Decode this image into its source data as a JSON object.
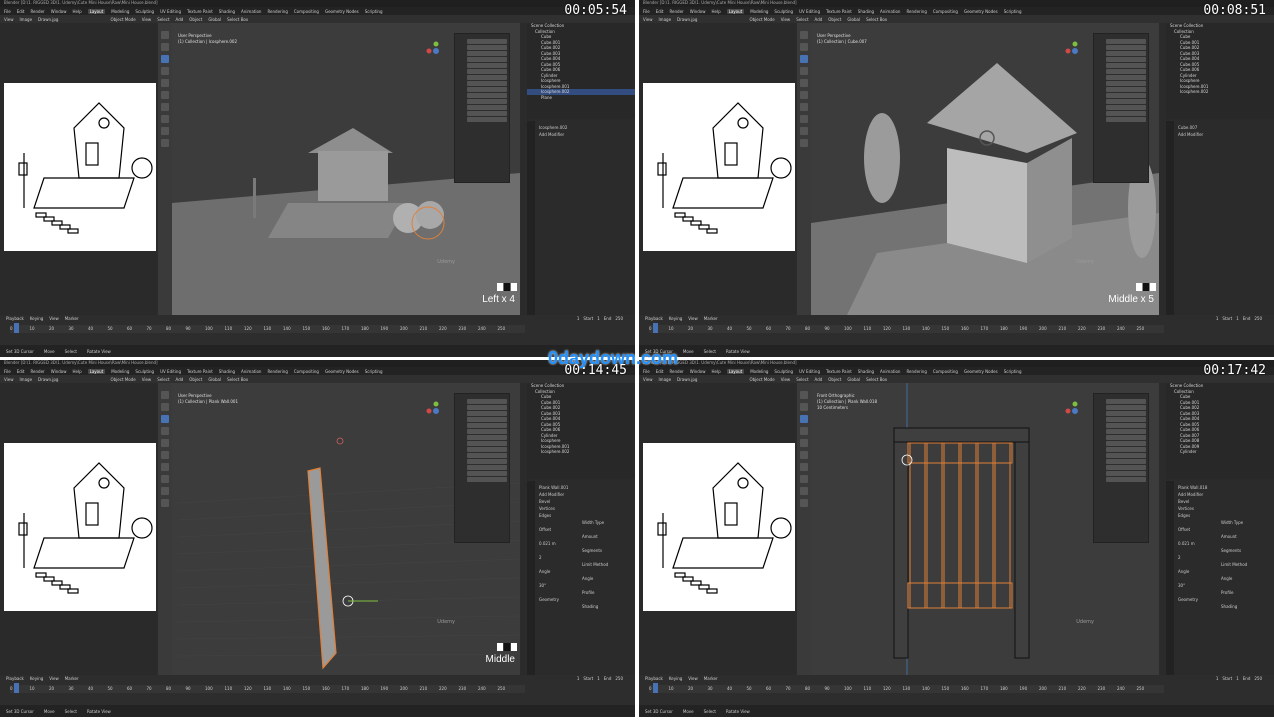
{
  "title_bar": "Blender [D:\\1. RIGGED 3D\\1. Udemy\\Cute Mini House\\Raw\\Mini House.blend]",
  "menus": [
    "File",
    "Edit",
    "Render",
    "Window",
    "Help"
  ],
  "workspaces": [
    "Layout",
    "Modeling",
    "Sculpting",
    "UV Editing",
    "Texture Paint",
    "Shading",
    "Animation",
    "Rendering",
    "Compositing",
    "Geometry Nodes",
    "Scripting"
  ],
  "image_editor": {
    "view": "View",
    "image": "Image",
    "file": "Drawn.jpg"
  },
  "viewport_header": {
    "mode": "Object Mode",
    "view": "View",
    "select": "Select",
    "add": "Add",
    "object": "Object",
    "orientation": "Global",
    "scene": "Scene",
    "drag": "Select Box"
  },
  "timeline": {
    "playback": "Playback",
    "keying": "Keying",
    "view": "View",
    "marker": "Marker",
    "start_label": "Start",
    "start": "1",
    "end_label": "End",
    "end": "250",
    "current": "1",
    "ticks": [
      "0",
      "10",
      "20",
      "30",
      "40",
      "50",
      "60",
      "70",
      "80",
      "90",
      "100",
      "110",
      "120",
      "130",
      "140",
      "150",
      "160",
      "170",
      "180",
      "190",
      "200",
      "210",
      "220",
      "230",
      "240",
      "250"
    ]
  },
  "status": {
    "cursor": "Set 3D Cursor",
    "move": "Move",
    "rotate": "Rotate View",
    "select": "Select"
  },
  "watermark": "0daydown.com",
  "udemy": "Udemy",
  "panels": [
    {
      "timestamp": "00:05:54",
      "keycast": "Left x 4",
      "info": [
        "User Perspective",
        "(1) Collection | Icosphere.002"
      ],
      "outliner": [
        "Scene Collection",
        "Collection",
        "Cube",
        "Cube.001",
        "Cube.002",
        "Cube.003",
        "Cube.004",
        "Cube.005",
        "Cube.006",
        "Cylinder",
        "Icosphere",
        "Icosphere.001",
        "Icosphere.002",
        "Plane"
      ],
      "selected": 12,
      "props": [
        "Icosphere.002",
        "Add Modifier"
      ]
    },
    {
      "timestamp": "00:08:51",
      "keycast": "Middle x 5",
      "info": [
        "User Perspective",
        "(1) Collection | Cube.007"
      ],
      "outliner": [
        "Scene Collection",
        "Collection",
        "Cube",
        "Cube.001",
        "Cube.002",
        "Cube.003",
        "Cube.004",
        "Cube.005",
        "Cube.006",
        "Cylinder",
        "Icosphere",
        "Icosphere.001",
        "Icosphere.002"
      ],
      "selected": -1,
      "props": [
        "Cube.007",
        "Add Modifier"
      ]
    },
    {
      "timestamp": "00:14:45",
      "keycast": "Middle",
      "info": [
        "User Perspective",
        "(1) Collection | Plank Wall.001"
      ],
      "outliner": [
        "Scene Collection",
        "Collection",
        "Cube",
        "Cube.001",
        "Cube.002",
        "Cube.003",
        "Cube.004",
        "Cube.005",
        "Cube.006",
        "Cylinder",
        "Icosphere",
        "Icosphere.001",
        "Icosphere.002"
      ],
      "selected": -1,
      "props": [
        "Plank Wall.001",
        "Add Modifier",
        "Bevel",
        "Vertices",
        "Edges",
        "Width Type",
        "Offset",
        "Amount",
        "0.021 m",
        "Segments",
        "2",
        "Limit Method",
        "Angle",
        "Angle",
        "30°",
        "Profile",
        "Geometry",
        "Shading"
      ]
    },
    {
      "timestamp": "00:17:42",
      "keycast": "",
      "info": [
        "Front Orthographic",
        "(1) Collection | Plank Wall.018",
        "10 Centimeters"
      ],
      "outliner": [
        "Scene Collection",
        "Collection",
        "Cube",
        "Cube.001",
        "Cube.002",
        "Cube.003",
        "Cube.004",
        "Cube.005",
        "Cube.006",
        "Cube.007",
        "Cube.008",
        "Cube.009",
        "Cylinder"
      ],
      "selected": -1,
      "props": [
        "Plank Wall.018",
        "Add Modifier",
        "Bevel",
        "Vertices",
        "Edges",
        "Width Type",
        "Offset",
        "Amount",
        "0.021 m",
        "Segments",
        "2",
        "Limit Method",
        "Angle",
        "Angle",
        "30°",
        "Profile",
        "Geometry",
        "Shading"
      ]
    }
  ]
}
